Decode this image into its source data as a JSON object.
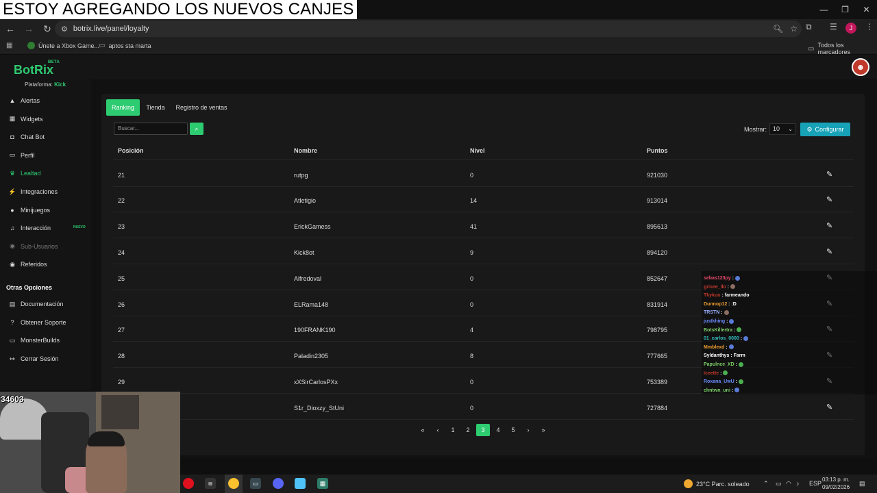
{
  "stream": {
    "title": "ESTOY AGREGANDO LOS NUEVOS CANJES",
    "viewer_count": "34603"
  },
  "browser": {
    "url": "botrix.live/panel/loyalty",
    "bookmarks": [
      "Únete a Xbox Game...",
      "aptos sta marta"
    ],
    "all_bookmarks_label": "Todos los marcadores",
    "profile_initial": "J",
    "window_controls": [
      "—",
      "❐",
      "✕"
    ]
  },
  "app": {
    "brand": "BotRix",
    "beta_label": "BETA",
    "platform_label": "Plataforma:",
    "platform_value": "Kick"
  },
  "sidebar": {
    "items": [
      {
        "label": "Alertas",
        "icon": "warning-icon"
      },
      {
        "label": "Widgets",
        "icon": "grid-icon"
      },
      {
        "label": "Chat Bot",
        "icon": "robot-icon"
      },
      {
        "label": "Perfil",
        "icon": "id-card-icon"
      },
      {
        "label": "Lealtad",
        "icon": "trophy-icon",
        "active": true
      },
      {
        "label": "Integraciones",
        "icon": "plug-icon"
      },
      {
        "label": "Minijuegos",
        "icon": "gamepad-icon"
      },
      {
        "label": "Interacción",
        "icon": "music-icon",
        "badge": "NUEVO"
      },
      {
        "label": "Sub-Usuarios",
        "icon": "users-icon",
        "disabled": true
      },
      {
        "label": "Referidos",
        "icon": "users-icon"
      }
    ],
    "section_title": "Otras Opciones",
    "other_items": [
      {
        "label": "Documentación",
        "icon": "book-icon"
      },
      {
        "label": "Obtener Soporte",
        "icon": "question-icon"
      },
      {
        "label": "MonsterBuilds",
        "icon": "monitor-icon"
      },
      {
        "label": "Cerrar Sesión",
        "icon": "sign-out-icon"
      }
    ]
  },
  "main": {
    "tabs": [
      "Ranking",
      "Tienda",
      "Registro de ventas"
    ],
    "search_placeholder": "Buscar...",
    "mostrar_label": "Mostrar:",
    "mostrar_value": "10",
    "config_label": "Configurar",
    "columns": [
      "Posición",
      "Nombre",
      "Nivel",
      "Puntos"
    ],
    "rows": [
      {
        "pos": "21",
        "name": "rutpg",
        "level": "0",
        "points": "921030"
      },
      {
        "pos": "22",
        "name": "Atletigio",
        "level": "14",
        "points": "913014"
      },
      {
        "pos": "23",
        "name": "ErickGamess",
        "level": "41",
        "points": "895613"
      },
      {
        "pos": "24",
        "name": "Kick8ot",
        "level": "9",
        "points": "894120"
      },
      {
        "pos": "25",
        "name": "Alfredoval",
        "level": "0",
        "points": "852647"
      },
      {
        "pos": "26",
        "name": "ELRama148",
        "level": "0",
        "points": "831914"
      },
      {
        "pos": "27",
        "name": "190FRANK190",
        "level": "4",
        "points": "798795"
      },
      {
        "pos": "28",
        "name": "Paladin2305",
        "level": "8",
        "points": "777665"
      },
      {
        "pos": "29",
        "name": "xXSirCarlosPXx",
        "level": "0",
        "points": "753389"
      },
      {
        "pos": "",
        "name": "S1r_Dioxzy_StUni",
        "level": "0",
        "points": "727884"
      }
    ],
    "pagination": [
      "«",
      "‹",
      "1",
      "2",
      "3",
      "4",
      "5",
      "›",
      "»"
    ],
    "current_page": "3"
  },
  "chat": [
    {
      "user": "sebas123py",
      "msg": "",
      "color": "#e84a6b",
      "emote": "blue"
    },
    {
      "user": "grisee_llo",
      "msg": "",
      "color": "#c0392b",
      "emote": "brown"
    },
    {
      "user": "Tkykuo",
      "msg": "farmeando",
      "color": "#c0392b",
      "emote": ""
    },
    {
      "user": "Dunnop12",
      "msg": ":D",
      "color": "#f0a030",
      "emote": ""
    },
    {
      "user": "TRSTN",
      "msg": "",
      "color": "#9bb0ff",
      "emote": "brown"
    },
    {
      "user": "justkhing",
      "msg": "",
      "color": "#6a8cff",
      "emote": "blue"
    },
    {
      "user": "BotsKillertra",
      "msg": "",
      "color": "#7fd36a",
      "emote": "green"
    },
    {
      "user": "01_carlos_0000",
      "msg": "",
      "color": "#36c0c0",
      "emote": "blue"
    },
    {
      "user": "Mmblexd",
      "msg": "",
      "color": "#f0a030",
      "emote": "blue"
    },
    {
      "user": "Syldanthys",
      "msg": "Farm",
      "color": "#ffffff",
      "emote": ""
    },
    {
      "user": "Papulnce_XD",
      "msg": "",
      "color": "#7fd36a",
      "emote": "green"
    },
    {
      "user": "Iceette",
      "msg": "",
      "color": "#c0392b",
      "emote": "green"
    },
    {
      "user": "Roxana_UwU",
      "msg": "",
      "color": "#6a8cff",
      "emote": "green"
    },
    {
      "user": "chntwn_uni",
      "msg": "",
      "color": "#7fd36a",
      "emote": "blue"
    }
  ],
  "taskbar": {
    "weather": "23°C  Parc. soleado",
    "language": "ESP",
    "time": "03:13 p. m.",
    "date": "09/02/2026"
  },
  "colors": {
    "accent": "#2ecc71",
    "info": "#17a2b8",
    "bg": "#191919"
  }
}
